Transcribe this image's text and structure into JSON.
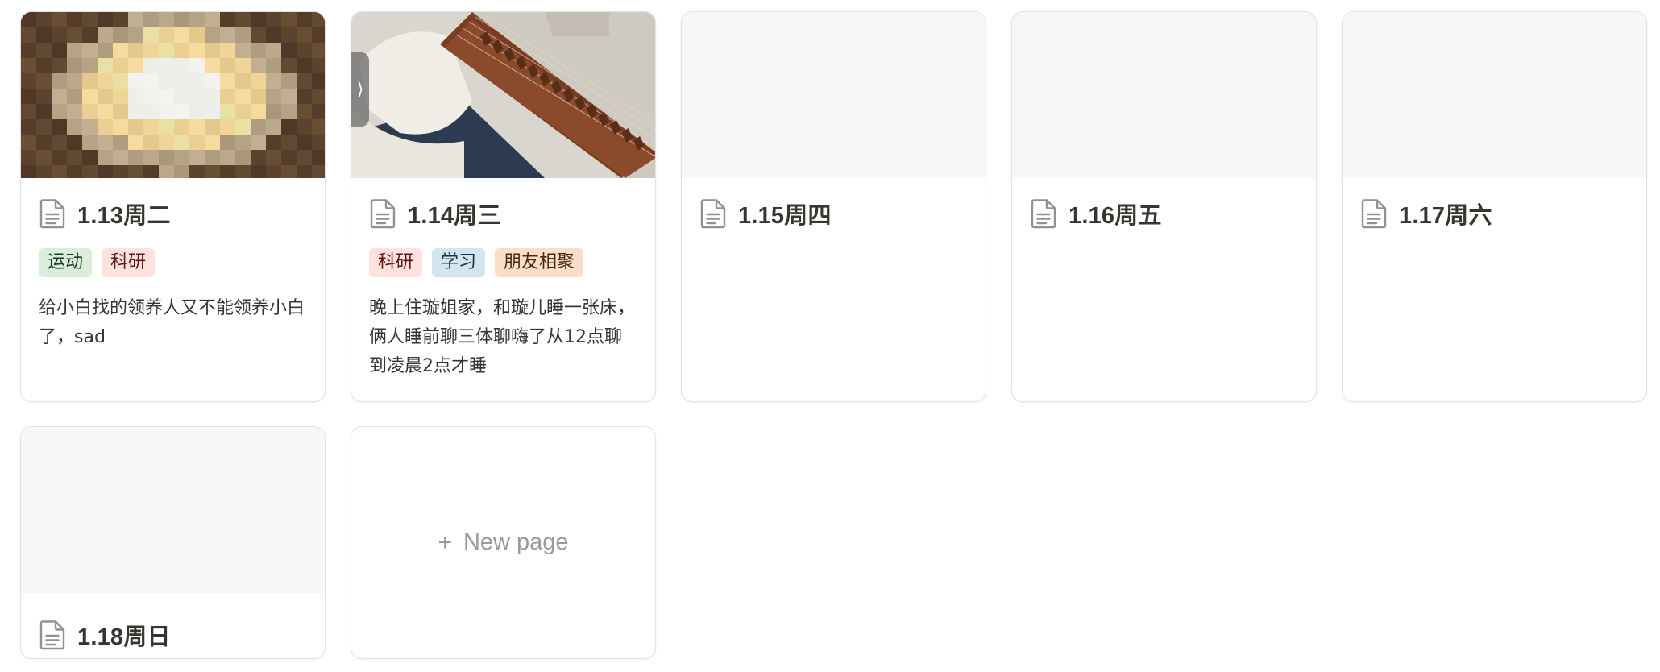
{
  "gallery": {
    "new_page_label": "New page",
    "cards": [
      {
        "title": "1.13周二",
        "tags": [
          {
            "label": "运动",
            "color": "#dbeddb"
          },
          {
            "label": "科研",
            "color": "#ffe2dd"
          }
        ],
        "note": "给小白找的领养人又不能领养小白了，sad",
        "cover": "blurred-photo"
      },
      {
        "title": "1.14周三",
        "tags": [
          {
            "label": "科研",
            "color": "#ffe2dd"
          },
          {
            "label": "学习",
            "color": "#d3e5ef"
          },
          {
            "label": "朋友相聚",
            "color": "#fadec9"
          }
        ],
        "note": "晚上住璇姐家，和璇儿睡一张床，俩人睡前聊三体聊嗨了从12点聊到凌晨2点才睡",
        "cover": "guzheng-photo"
      },
      {
        "title": "1.15周四",
        "tags": [],
        "note": "",
        "cover": "empty"
      },
      {
        "title": "1.16周五",
        "tags": [],
        "note": "",
        "cover": "empty"
      },
      {
        "title": "1.17周六",
        "tags": [],
        "note": "",
        "cover": "empty"
      },
      {
        "title": "1.18周日",
        "tags": [],
        "note": "",
        "cover": "empty"
      }
    ]
  },
  "icons": {
    "page": "page-document-icon",
    "plus": "plus-icon",
    "handle": "chevron-right-icon"
  },
  "handle_glyph": "⟩",
  "plus_glyph": "+"
}
